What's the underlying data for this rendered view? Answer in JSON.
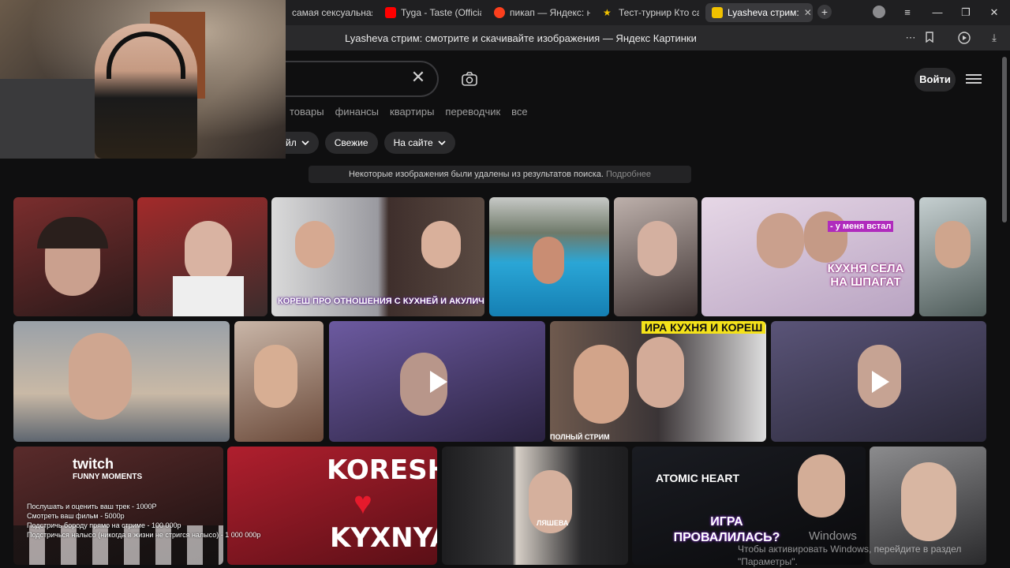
{
  "browser": {
    "tabs": [
      {
        "label": "самая сексуальная",
        "favicon_color": "#2d6cdf",
        "active": false
      },
      {
        "label": "Tyga - Taste (Official",
        "favicon_color": "#ff0000",
        "active": false
      },
      {
        "label": "пикап — Яндекс: на",
        "favicon_color": "#fc3f1d",
        "active": false
      },
      {
        "label": "Тест-турнир Кто са",
        "favicon_color": "#f2c200",
        "active": false
      },
      {
        "label": "Lyasheva стрим:",
        "favicon_color": "#f2c200",
        "active": true
      }
    ],
    "page_title": "Lyasheva стрим: смотрите и скачивайте изображения — Яндекс Картинки"
  },
  "header": {
    "login_label": "Войти",
    "services": [
      "товары",
      "финансы",
      "квартиры",
      "переводчик",
      "все"
    ],
    "filters": [
      {
        "label": "йл",
        "has_dropdown": true
      },
      {
        "label": "Свежие",
        "has_dropdown": false
      },
      {
        "label": "На сайте",
        "has_dropdown": true
      }
    ]
  },
  "notice": {
    "text": "Некоторые изображения были удалены из результатов поиска.",
    "link": "Подробнее"
  },
  "grid": {
    "row1": [
      {
        "caption": "",
        "bg": "#6a2a2a"
      },
      {
        "caption": "",
        "bg": "#5b3a3a"
      },
      {
        "caption": "КОРЕШ ПРО ОТНОШЕНИЯ С КУХНЕЙ И АКУЛИЧ",
        "bg": "#6d6a72"
      },
      {
        "caption": "",
        "bg": "#3a83b5"
      },
      {
        "caption": "",
        "bg": "#7a6b6a"
      },
      {
        "caption": "КУХНЯ СЕЛА НА ШПАГАТ",
        "caption2": "- у меня встал",
        "bg": "#c7b2c9"
      },
      {
        "caption": "",
        "bg": "#7c8a8c"
      }
    ],
    "row2": [
      {
        "caption": "",
        "bg": "#8a8f94",
        "video": false
      },
      {
        "caption": "",
        "bg": "#8a6a5a",
        "video": false
      },
      {
        "caption": "",
        "bg": "#4b3f6b",
        "video": true
      },
      {
        "caption": "ИРА КУХНЯ И КОРЕШ",
        "caption2": "ПОЛНЫЙ СТРИМ",
        "bg": "#3c3c3e",
        "video": false
      },
      {
        "caption": "",
        "bg": "#4d4a63",
        "video": true
      }
    ],
    "row3": [
      {
        "caption": "twitch",
        "caption2": "FUNNY MOMENTS",
        "bg": "#5a2b2b"
      },
      {
        "caption": "KORESH",
        "caption2": "KYXNYA",
        "bg": "#8a1f2a"
      },
      {
        "caption": "ЛЯШЕВА",
        "bg": "#1d1d1f"
      },
      {
        "caption": "ATOMIC HEART",
        "caption2": "ИГРА ПРОВАЛИЛАСЬ?",
        "bg": "#141416"
      },
      {
        "caption": "",
        "bg": "#3b3b3d"
      }
    ]
  },
  "stream_overlay": {
    "lines": [
      "Послушать и оценить ваш трек - 1000Р",
      "Смотреть ваш фильм - 5000р",
      "Подстричь бороду прямо на стриме - 100 000р",
      "Подстричься налысо (никогда в жизни не стригся налысо) - 1 000 000р"
    ]
  },
  "windows_activation": {
    "title": "Windows",
    "text": "Чтобы активировать Windows, перейдите в раздел",
    "text2": "\"Параметры\"."
  }
}
